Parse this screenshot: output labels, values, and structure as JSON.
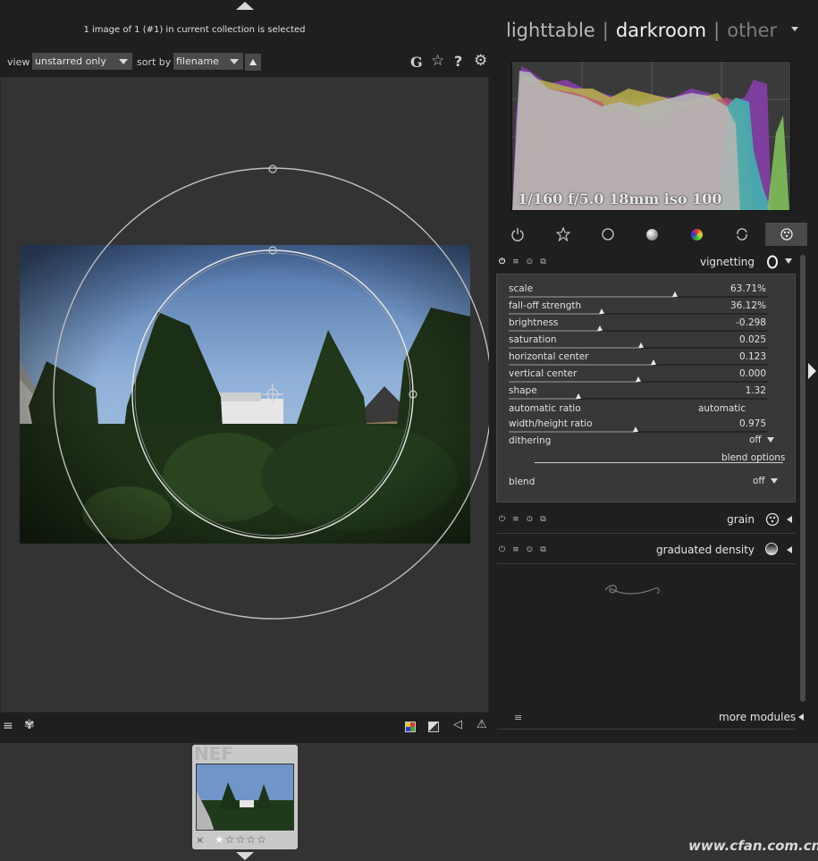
{
  "header": {
    "selection_info": "1 image of 1 (#1) in current collection is selected"
  },
  "filter_bar": {
    "view_label": "view",
    "view_value": "unstarred only",
    "sort_label": "sort by",
    "sort_value": "filename",
    "icons": [
      "grouping-icon",
      "star-icon",
      "help-icon",
      "gear-icon"
    ],
    "glyph_grouping": "G",
    "glyph_star": "☆",
    "glyph_help": "?",
    "glyph_gear": "⚙"
  },
  "view_switcher": {
    "lighttable": "lighttable",
    "darkroom": "darkroom",
    "other": "other",
    "sep": "|"
  },
  "histogram": {
    "exif": "1/160 f/5.0 18mm iso 100"
  },
  "module_groups": [
    "power-icon",
    "favorite-star-icon",
    "basic-circle-icon",
    "tone-circle-icon",
    "color-circle-icon",
    "correct-icon",
    "effect-icon"
  ],
  "vignetting": {
    "name": "vignetting",
    "sliders": [
      {
        "label": "scale",
        "value": "63.71%",
        "pos": 0.64
      },
      {
        "label": "fall-off strength",
        "value": "36.12%",
        "pos": 0.36
      },
      {
        "label": "brightness",
        "value": "-0.298",
        "pos": 0.35
      },
      {
        "label": "saturation",
        "value": "0.025",
        "pos": 0.51
      },
      {
        "label": "horizontal center",
        "value": "0.123",
        "pos": 0.56
      },
      {
        "label": "vertical center",
        "value": "0.000",
        "pos": 0.5
      },
      {
        "label": "shape",
        "value": "1.32",
        "pos": 0.27
      }
    ],
    "auto_ratio_label": "automatic ratio",
    "auto_ratio_value": "automatic",
    "wh_ratio": {
      "label": "width/height ratio",
      "value": "0.975",
      "pos": 0.49
    },
    "dithering_label": "dithering",
    "dithering_value": "off",
    "blend_options": "blend options",
    "blend_label": "blend",
    "blend_value": "off"
  },
  "modules": {
    "grain": "grain",
    "graduated_density": "graduated density",
    "more_modules": "more modules"
  },
  "filmstrip": {
    "ext_label": "NEF",
    "reject": "×"
  },
  "watermark": "www.cfan.com.cn"
}
